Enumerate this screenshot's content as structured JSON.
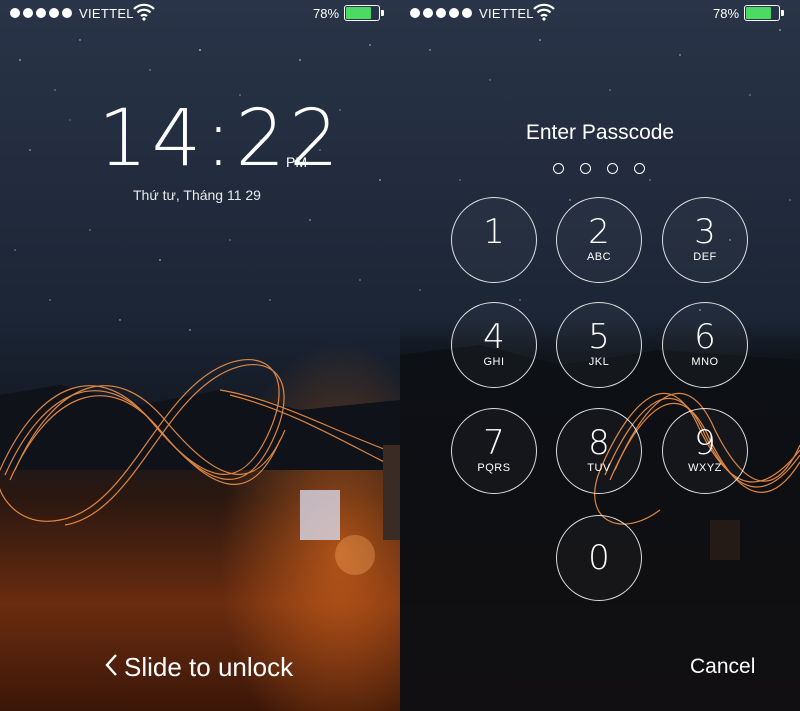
{
  "status_bar": {
    "carrier": "VIETTEL",
    "battery_percent": "78%",
    "battery_level": 0.78,
    "signal_bars": 5
  },
  "lock_screen": {
    "time": "14:22",
    "ampm": "PM",
    "date": "Thứ tư, Tháng 11 29",
    "slide_label": "Slide to unlock"
  },
  "passcode_screen": {
    "title": "Enter Passcode",
    "cancel_label": "Cancel",
    "keys": [
      {
        "num": "1",
        "letters": ""
      },
      {
        "num": "2",
        "letters": "ABC"
      },
      {
        "num": "3",
        "letters": "DEF"
      },
      {
        "num": "4",
        "letters": "GHI"
      },
      {
        "num": "5",
        "letters": "JKL"
      },
      {
        "num": "6",
        "letters": "MNO"
      },
      {
        "num": "7",
        "letters": "PQRS"
      },
      {
        "num": "8",
        "letters": "TUV"
      },
      {
        "num": "9",
        "letters": "WXYZ"
      },
      {
        "num": "0",
        "letters": ""
      }
    ]
  },
  "colors": {
    "battery_fill": "#4cd964",
    "sky_top": "#1a2436",
    "ground": "#3a1a0c",
    "light_trail": "#ff8a3a"
  },
  "icons": [
    "wifi-icon",
    "battery-icon",
    "chevron-left-icon"
  ]
}
